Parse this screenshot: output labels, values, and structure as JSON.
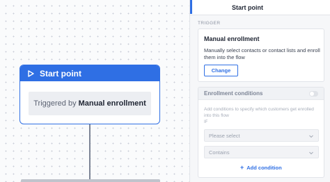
{
  "canvas": {
    "node": {
      "title": "Start point",
      "body_prefix": "Triggered by",
      "body_value": "Manual enrollment"
    }
  },
  "panel": {
    "tab_label": "Start point",
    "section_label": "TRIGGER",
    "trigger": {
      "title": "Manual enrollment",
      "description": "Manually select contacts or contact lists and enroll them into the flow",
      "change_label": "Change"
    },
    "conditions": {
      "title": "Enrollment conditions",
      "enabled": false,
      "description": "Add conditions to specify which customers get enrolled into this flow",
      "if_label": "IF",
      "select_placeholder": "Please select",
      "operator_value": "Contains",
      "add_label": "Add condition"
    }
  },
  "colors": {
    "accent": "#2f6fe4"
  },
  "icons": {
    "play": "play-icon",
    "chevron": "chevron-down-icon",
    "plus": "plus-icon"
  }
}
